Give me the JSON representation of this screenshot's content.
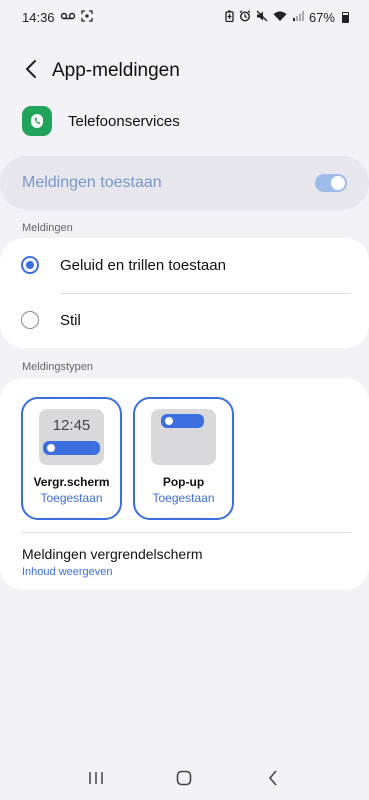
{
  "status_bar": {
    "time": "14:36",
    "battery": "67%",
    "icons": [
      "voicemail-icon",
      "screenshot-icon",
      "battery-saver-icon",
      "alarm-icon",
      "mute-icon",
      "wifi-icon",
      "signal-icon",
      "battery-icon"
    ]
  },
  "header": {
    "back_icon": "back-arrow-icon",
    "title": "App-meldingen"
  },
  "app": {
    "name": "Telefoonservices",
    "icon": "phone-app-icon",
    "icon_color": "#21a35b"
  },
  "master_toggle": {
    "label": "Meldingen toestaan",
    "on": true
  },
  "meldingen": {
    "section_title": "Meldingen",
    "options": [
      {
        "label": "Geluid en trillen toestaan",
        "selected": true
      },
      {
        "label": "Stil",
        "selected": false
      }
    ]
  },
  "meldingstypen": {
    "section_title": "Meldingstypen",
    "tiles": [
      {
        "title": "Vergr.scherm",
        "status": "Toegestaan",
        "preview_time": "12:45"
      },
      {
        "title": "Pop-up",
        "status": "Toegestaan"
      }
    ],
    "lockscreen": {
      "title": "Meldingen vergrendelscherm",
      "subtitle": "Inhoud weergeven"
    }
  },
  "nav_bar": {
    "buttons": [
      "recent-apps-icon",
      "home-icon",
      "back-icon"
    ]
  },
  "colors": {
    "accent": "#3b6fe0",
    "background": "#f2f2f6",
    "toggle_disabled": "#9fbbe9",
    "label_disabled": "#7a96c8"
  }
}
